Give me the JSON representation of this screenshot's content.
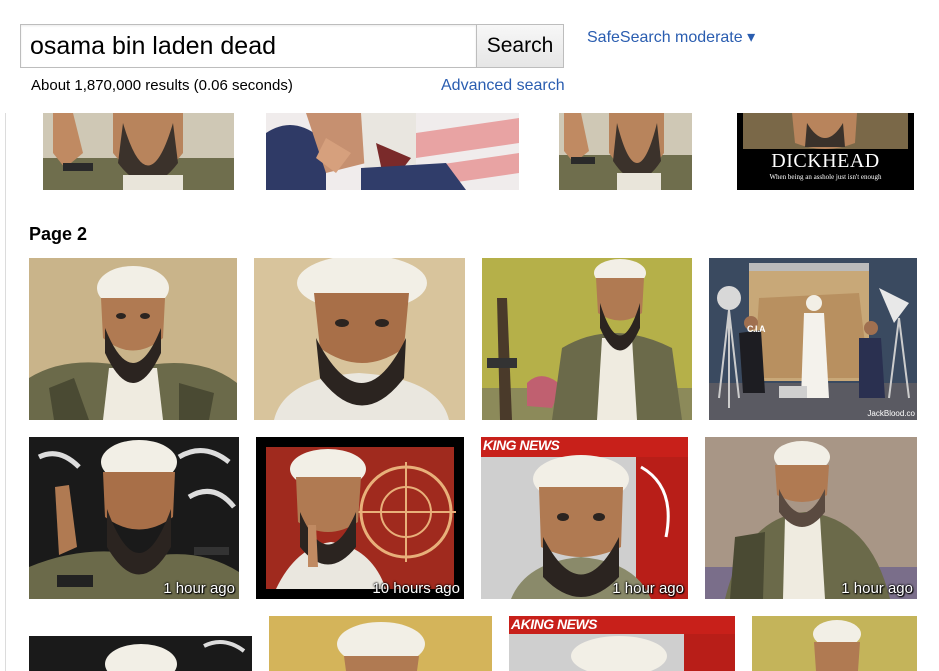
{
  "search": {
    "query": "osama bin laden dead",
    "button_label": "Search",
    "safesearch_label": "SafeSearch moderate ▾"
  },
  "results": {
    "stats": "About 1,870,000 results (0.06 seconds)",
    "advanced_link": "Advanced search"
  },
  "page_section": {
    "label": "Page 2"
  },
  "thumbnails": {
    "row_top": [
      {
        "caption": ""
      },
      {
        "caption": ""
      },
      {
        "caption": ""
      },
      {
        "caption": "",
        "poster_title": "DICKHEAD",
        "poster_sub": "When being an asshole just isn't enough"
      }
    ],
    "row_2": [
      {
        "caption": ""
      },
      {
        "caption": ""
      },
      {
        "caption": ""
      },
      {
        "caption": "",
        "sign_text": "C.I.A",
        "watermark": "JackBlood.co"
      }
    ],
    "row_3": [
      {
        "time": "1 hour ago"
      },
      {
        "time": "10 hours ago"
      },
      {
        "time": "1 hour ago",
        "banner": "KING NEWS"
      },
      {
        "time": "1 hour ago"
      }
    ],
    "row_4": [
      {
        "caption": ""
      },
      {
        "caption": ""
      },
      {
        "banner": "AKING NEWS"
      },
      {
        "caption": ""
      }
    ]
  },
  "colors": {
    "link": "#2a5db0",
    "turban": "#f2efe6",
    "skin": "#b07a52",
    "beard": "#2b2420",
    "camo": "#6b6a4a"
  }
}
